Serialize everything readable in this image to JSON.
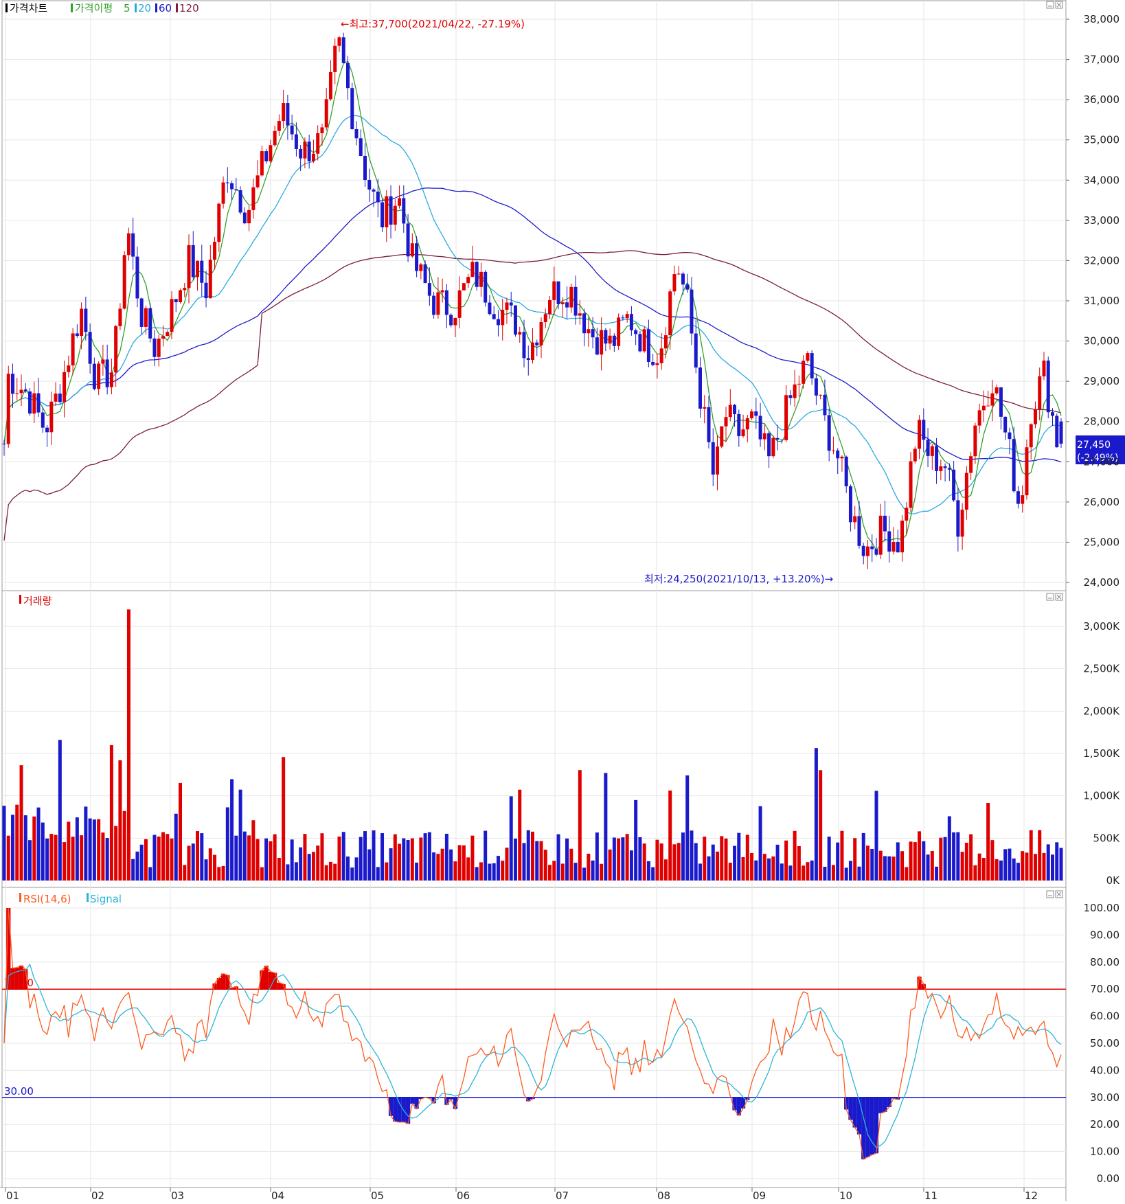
{
  "legend": {
    "price": {
      "label": "가격차트",
      "color": "#000000"
    },
    "ma_label": {
      "label": "가격이평",
      "color": "#33a02c"
    },
    "ma5": {
      "label": "5",
      "color": "#33a02c"
    },
    "ma20": {
      "label": "20",
      "color": "#2aa9e0"
    },
    "ma60": {
      "label": "60",
      "color": "#1a1acc"
    },
    "ma120": {
      "label": "120",
      "color": "#7a1f3d"
    },
    "volume": {
      "label": "거래량",
      "color": "#e00000"
    },
    "rsi": {
      "label": "RSI(14,6)",
      "color": "#ff5a1f"
    },
    "signal": {
      "label": "Signal",
      "color": "#2bb5d8"
    }
  },
  "annotations": {
    "high": "←최고:37,700(2021/04/22, -27.19%)",
    "low": "최저:24,250(2021/10/13, +13.20%)→",
    "current_price": "27,450",
    "current_change": "(-2.49%)"
  },
  "colors": {
    "up": "#e00000",
    "down": "#1a1acc",
    "rsi_line": "#ff5a1f",
    "signal_line": "#2bb5d8",
    "overbought": "#e00000",
    "oversold": "#1a1acc"
  },
  "chart_data": [
    {
      "type": "candlestick",
      "title": "가격차트",
      "ylim": [
        24000,
        38000
      ],
      "yticks": [
        "38,000",
        "37,000",
        "36,000",
        "35,000",
        "34,000",
        "33,000",
        "32,000",
        "31,000",
        "30,000",
        "29,000",
        "28,000",
        "27,000",
        "26,000",
        "25,000",
        "24,000"
      ],
      "xticks": [
        "01",
        "02",
        "03",
        "04",
        "05",
        "06",
        "07",
        "08",
        "09",
        "10",
        "11",
        "12"
      ],
      "key_points": [
        {
          "label": "2021/01 start",
          "close": 29200
        },
        {
          "label": "2021/03 high area",
          "close": 33300
        },
        {
          "label": "2021/04/22 high",
          "high": 37700
        },
        {
          "label": "2021/05 decline",
          "close": 32000
        },
        {
          "label": "2021/08 rebound",
          "close": 32400
        },
        {
          "label": "2021/10/13 low",
          "low": 24250
        },
        {
          "label": "2021/12 last",
          "close": 27450
        }
      ],
      "ma_series": [
        "5",
        "20",
        "60",
        "120"
      ]
    },
    {
      "type": "bar",
      "title": "거래량",
      "ylim": [
        0,
        3300000
      ],
      "yticks": [
        "3,000K",
        "2,500K",
        "2,000K",
        "1,500K",
        "1,000K",
        "500K",
        "0K"
      ],
      "peak": {
        "label": "2021/02 spike",
        "value": 3200000
      }
    },
    {
      "type": "line",
      "title": "RSI(14,6)",
      "ylim": [
        0,
        100
      ],
      "yticks": [
        "100.00",
        "90.00",
        "80.00",
        "70.00",
        "60.00",
        "50.00",
        "40.00",
        "30.00",
        "20.00",
        "10.00",
        "0.00"
      ],
      "levels": {
        "overbought": "70.00",
        "oversold": "30.00"
      }
    }
  ]
}
